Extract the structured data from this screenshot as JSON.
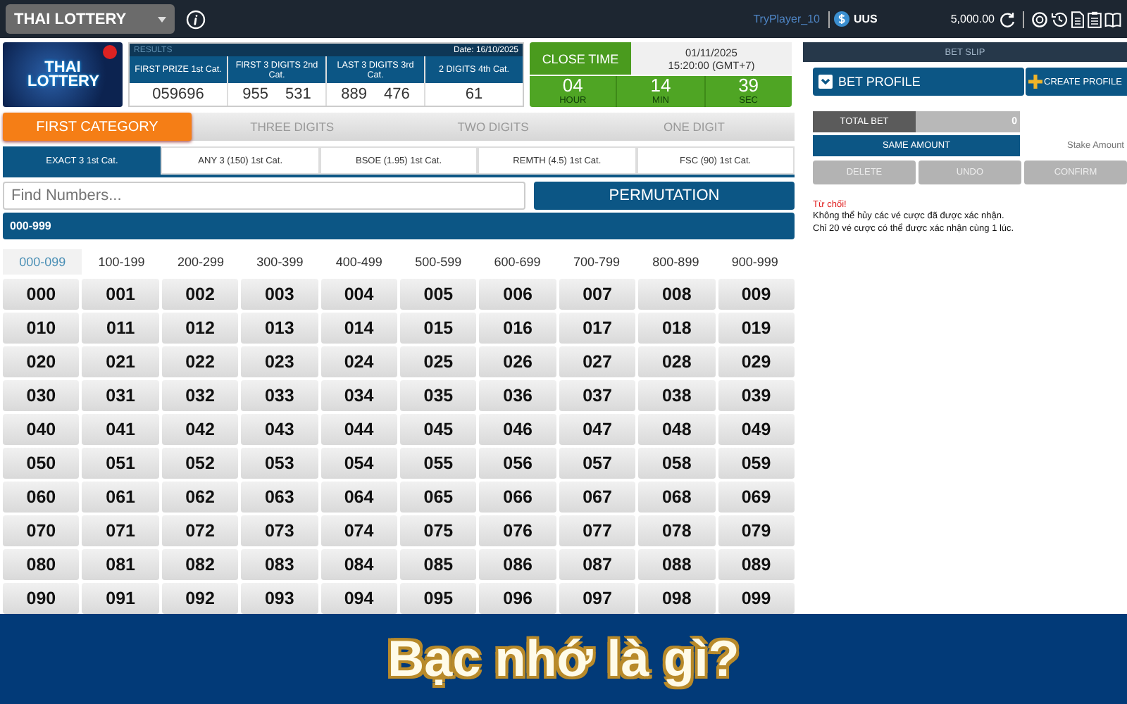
{
  "topbar": {
    "game": "THAI LOTTERY",
    "player": "TryPlayer_10",
    "currency": "UUS",
    "balance": "5,000.00"
  },
  "results": {
    "logo": "THAI LOTTERY",
    "heading": "RESULTS",
    "date": "Date: 16/10/2025",
    "columns": [
      {
        "label": "FIRST PRIZE 1st Cat.",
        "values": [
          "059696"
        ]
      },
      {
        "label": "FIRST 3 DIGITS 2nd Cat.",
        "values": [
          "955",
          "531"
        ]
      },
      {
        "label": "LAST 3 DIGITS 3rd Cat.",
        "values": [
          "889",
          "476"
        ]
      },
      {
        "label": "2 DIGITS 4th Cat.",
        "values": [
          "61"
        ]
      }
    ]
  },
  "close_time": {
    "label": "CLOSE TIME",
    "date": "01/11/2025",
    "time": "15:20:00 (GMT+7)",
    "countdown": [
      {
        "value": "04",
        "unit": "HOUR"
      },
      {
        "value": "14",
        "unit": "MIN"
      },
      {
        "value": "39",
        "unit": "SEC"
      }
    ]
  },
  "category_tabs": [
    {
      "label": "FIRST CATEGORY",
      "selected": true
    },
    {
      "label": "THREE DIGITS",
      "selected": false
    },
    {
      "label": "TWO DIGITS",
      "selected": false
    },
    {
      "label": "ONE DIGIT",
      "selected": false
    }
  ],
  "bet_types": [
    {
      "label": "EXACT 3 1st Cat.",
      "selected": true
    },
    {
      "label": "ANY 3 (150) 1st Cat.",
      "selected": false
    },
    {
      "label": "BSOE (1.95) 1st Cat.",
      "selected": false
    },
    {
      "label": "REMTH (4.5) 1st Cat.",
      "selected": false
    },
    {
      "label": "FSC (90) 1st Cat.",
      "selected": false
    }
  ],
  "search": {
    "placeholder": "Find Numbers..."
  },
  "permutation_button": "PERMUTATION",
  "range_title": "000-999",
  "ranges": [
    {
      "label": "000-099",
      "selected": true
    },
    {
      "label": "100-199",
      "selected": false
    },
    {
      "label": "200-299",
      "selected": false
    },
    {
      "label": "300-399",
      "selected": false
    },
    {
      "label": "400-499",
      "selected": false
    },
    {
      "label": "500-599",
      "selected": false
    },
    {
      "label": "600-699",
      "selected": false
    },
    {
      "label": "700-799",
      "selected": false
    },
    {
      "label": "800-899",
      "selected": false
    },
    {
      "label": "900-999",
      "selected": false
    }
  ],
  "numbers": [
    "000",
    "001",
    "002",
    "003",
    "004",
    "005",
    "006",
    "007",
    "008",
    "009",
    "010",
    "011",
    "012",
    "013",
    "014",
    "015",
    "016",
    "017",
    "018",
    "019",
    "020",
    "021",
    "022",
    "023",
    "024",
    "025",
    "026",
    "027",
    "028",
    "029",
    "030",
    "031",
    "032",
    "033",
    "034",
    "035",
    "036",
    "037",
    "038",
    "039",
    "040",
    "041",
    "042",
    "043",
    "044",
    "045",
    "046",
    "047",
    "048",
    "049",
    "050",
    "051",
    "052",
    "053",
    "054",
    "055",
    "056",
    "057",
    "058",
    "059",
    "060",
    "061",
    "062",
    "063",
    "064",
    "065",
    "066",
    "067",
    "068",
    "069",
    "070",
    "071",
    "072",
    "073",
    "074",
    "075",
    "076",
    "077",
    "078",
    "079",
    "080",
    "081",
    "082",
    "083",
    "084",
    "085",
    "086",
    "087",
    "088",
    "089",
    "090",
    "091",
    "092",
    "093",
    "094",
    "095",
    "096",
    "097",
    "098",
    "099"
  ],
  "bet_slip": {
    "title": "BET SLIP",
    "profile_label": "BET PROFILE",
    "create_profile": "CREATE PROFILE",
    "total_bet_label": "TOTAL BET",
    "total_bet": "0",
    "same_amount": "SAME AMOUNT",
    "stake": {
      "placeholder": "Stake Amount"
    },
    "actions": [
      "DELETE",
      "UNDO",
      "CONFIRM"
    ],
    "notice_title": "Từ chối!",
    "notice_lines": [
      "Không thể hủy các vé cược đã được xác nhận.",
      "Chỉ 20 vé cược có thể được xác nhận cùng 1 lúc."
    ]
  },
  "banner": {
    "title": "Bạc nhớ là gì?"
  }
}
